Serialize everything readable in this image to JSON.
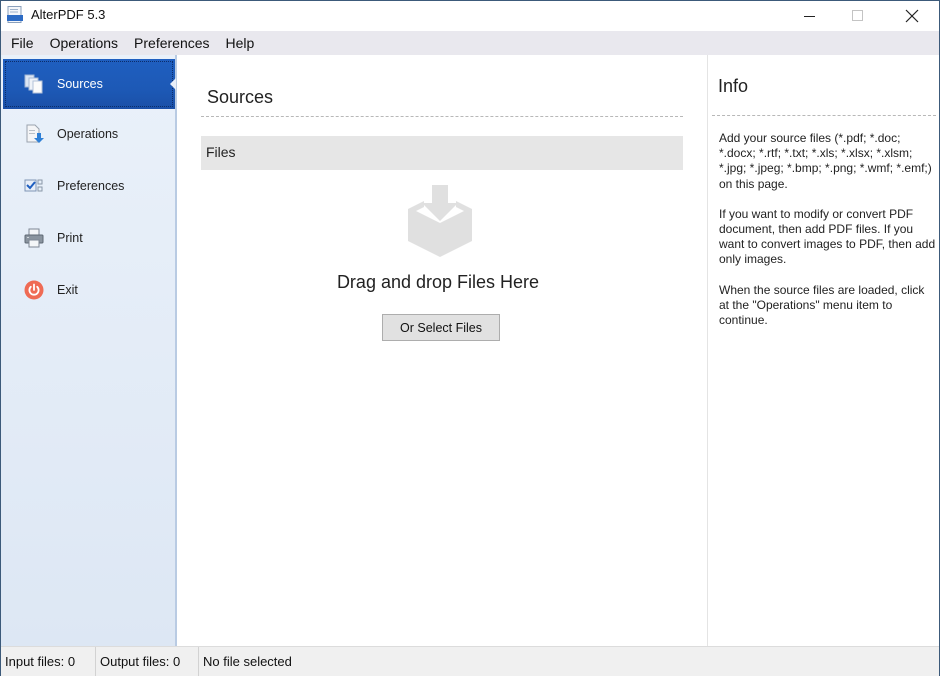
{
  "window": {
    "title": "AlterPDF 5.3",
    "app_icon": "pdf-app-icon",
    "controls": [
      "minimize",
      "maximize",
      "close"
    ]
  },
  "menubar": {
    "items": [
      {
        "label": "File"
      },
      {
        "label": "Operations"
      },
      {
        "label": "Preferences"
      },
      {
        "label": "Help"
      }
    ]
  },
  "sidebar": {
    "active_index": 0,
    "accent_color": "#1f5fc0",
    "items": [
      {
        "label": "Sources",
        "icon": "documents-icon"
      },
      {
        "label": "Operations",
        "icon": "document-arrow-icon"
      },
      {
        "label": "Preferences",
        "icon": "checkbox-list-icon"
      },
      {
        "label": "Print",
        "icon": "printer-icon"
      },
      {
        "label": "Exit",
        "icon": "power-icon"
      }
    ]
  },
  "main": {
    "title": "Sources",
    "files_header": "Files",
    "drop_text": "Drag and drop Files Here",
    "select_button": "Or Select Files",
    "drop_icon": "download-box-icon"
  },
  "info": {
    "title": "Info",
    "paragraphs": [
      "Add your source files (*.pdf; *.doc; *.docx; *.rtf; *.txt; *.xls; *.xlsx; *.xlsm; *.jpg; *.jpeg; *.bmp; *.png; *.wmf; *.emf;) on this page.",
      "If you want to modify or convert PDF document, then add PDF files. If you want to convert images to PDF, then add only images.",
      "When the source files are loaded, click at the \"Operations\" menu item to continue."
    ]
  },
  "statusbar": {
    "input_files": "Input files: 0",
    "output_files": "Output files: 0",
    "selection": "No file selected"
  }
}
